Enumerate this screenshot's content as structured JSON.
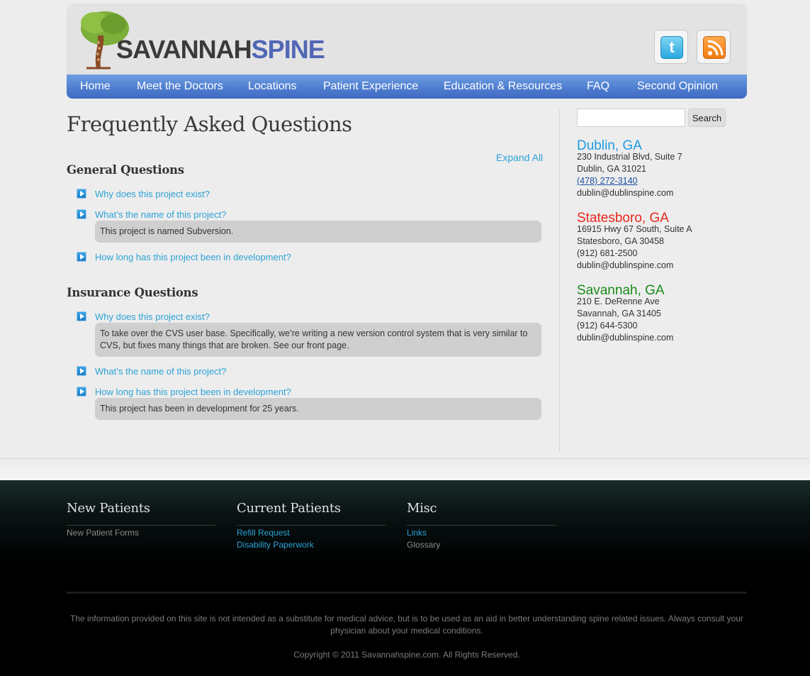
{
  "brand": {
    "logo_part1": "SAVANNAH",
    "logo_part2": "SPINE"
  },
  "social": [
    {
      "name": "twitter-icon",
      "glyph": "t"
    },
    {
      "name": "rss-icon"
    }
  ],
  "nav": {
    "items": [
      "Home",
      "Meet the Doctors",
      "Locations",
      "Patient Experience",
      "Education & Resources",
      "FAQ",
      "Second Opinion"
    ]
  },
  "main": {
    "title": "Frequently Asked Questions",
    "expand_all": "Expand All",
    "sections": [
      {
        "title": "General Questions",
        "questions": [
          {
            "q": "Why does this project exist?",
            "a": null
          },
          {
            "q": "What’s the name of this project?",
            "a": "This project is named Subversion."
          },
          {
            "q": "How long has this project been in development?",
            "a": null
          }
        ]
      },
      {
        "title": "Insurance Questions",
        "questions": [
          {
            "q": "Why does this project exist?",
            "a": "To take over the CVS user base. Specifically, we’re writing a new version control system that is very similar to CVS, but fixes many things that are broken. See our front page."
          },
          {
            "q": "What’s the name of this project?",
            "a": null
          },
          {
            "q": "How long has this project been in development?",
            "a": "This project has been in development for 25 years."
          }
        ]
      }
    ]
  },
  "sidebar": {
    "search": {
      "value": "",
      "button": "Search"
    },
    "locations": [
      {
        "name": "Dublin, GA",
        "color": "#1f9be0",
        "address1": "230 Industrial Blvd, Suite 7",
        "address2": "Dublin, GA 31021",
        "phone": "(478) 272-3140",
        "email": "dublin@dublinspine.com"
      },
      {
        "name": "Statesboro, GA",
        "color": "#e8261a",
        "address1": "16915 Hwy 67 South, Suite A",
        "address2": "Statesboro, GA 30458",
        "phone": "(912) 681-2500",
        "email": "dublin@dublinspine.com"
      },
      {
        "name": "Savannah, GA",
        "color": "#1a8a1a",
        "address1": "210 E. DeRenne Ave",
        "address2": "Savannah, GA 31405",
        "phone": "(912) 644-5300",
        "email": "dublin@dublinspine.com"
      }
    ]
  },
  "footer": {
    "columns": [
      {
        "title": "New Patients",
        "links": [
          {
            "label": "New Patient Forms",
            "style": "gray"
          }
        ]
      },
      {
        "title": "Current Patients",
        "links": [
          {
            "label": "Refill Request",
            "style": "blue"
          },
          {
            "label": "Disability Paperwork",
            "style": "blue"
          }
        ]
      },
      {
        "title": "Misc",
        "links": [
          {
            "label": "Links",
            "style": "blue"
          },
          {
            "label": "Glossary",
            "style": "gray"
          }
        ]
      }
    ],
    "disclaimer": "The information provided on this site is not intended as a substitute for medical advice, but is to be used as an aid in better understanding spine related issues. Always consult your physician about your medical conditions.",
    "copyright": "Copyright © 2011 Savannahspine.com. All Rights Reserved."
  }
}
